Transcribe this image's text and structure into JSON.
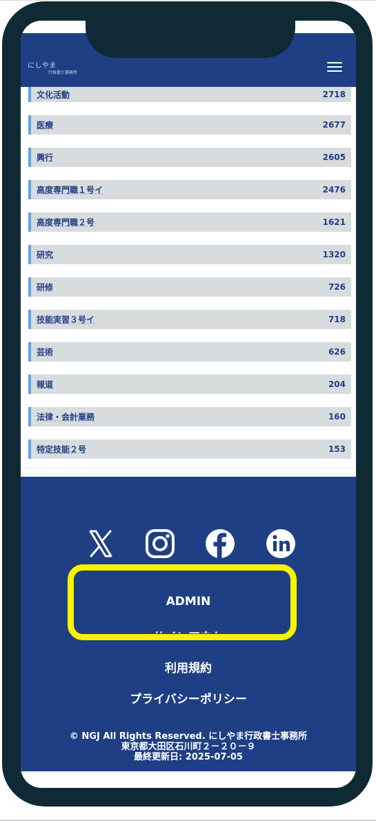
{
  "header": {
    "logo_main": "にしやま",
    "logo_sub": "行政書士事務所",
    "menu_icon": "hamburger-menu-icon"
  },
  "list": {
    "items": [
      {
        "label": "文化活動",
        "count": "2718"
      },
      {
        "label": "医療",
        "count": "2677"
      },
      {
        "label": "興行",
        "count": "2605"
      },
      {
        "label": "高度専門職１号イ",
        "count": "2476"
      },
      {
        "label": "高度専門職２号",
        "count": "1621"
      },
      {
        "label": "研究",
        "count": "1320"
      },
      {
        "label": "研修",
        "count": "726"
      },
      {
        "label": "技能実習３号イ",
        "count": "718"
      },
      {
        "label": "芸術",
        "count": "626"
      },
      {
        "label": "報道",
        "count": "204"
      },
      {
        "label": "法律・会計業務",
        "count": "160"
      },
      {
        "label": "特定技能２号",
        "count": "153"
      }
    ]
  },
  "footer": {
    "social": [
      "x-icon",
      "instagram-icon",
      "facebook-icon",
      "linkedin-icon"
    ],
    "admin": "ADMIN",
    "signout": "サインアウト",
    "terms": "利用規約",
    "privacy": "プライバシーポリシー",
    "copyright": "© NGJ All Rights Reserved. にしやま行政書士事務所",
    "address": "東京都大田区石川町２－２０－９",
    "updated": "最終更新日: 2025-07-05"
  },
  "colors": {
    "brand": "#1f3f85",
    "row_bg": "#d9dcdf",
    "row_accent": "#5ea3e4",
    "highlight": "#fbf200",
    "phone_frame": "#0f2a34"
  }
}
